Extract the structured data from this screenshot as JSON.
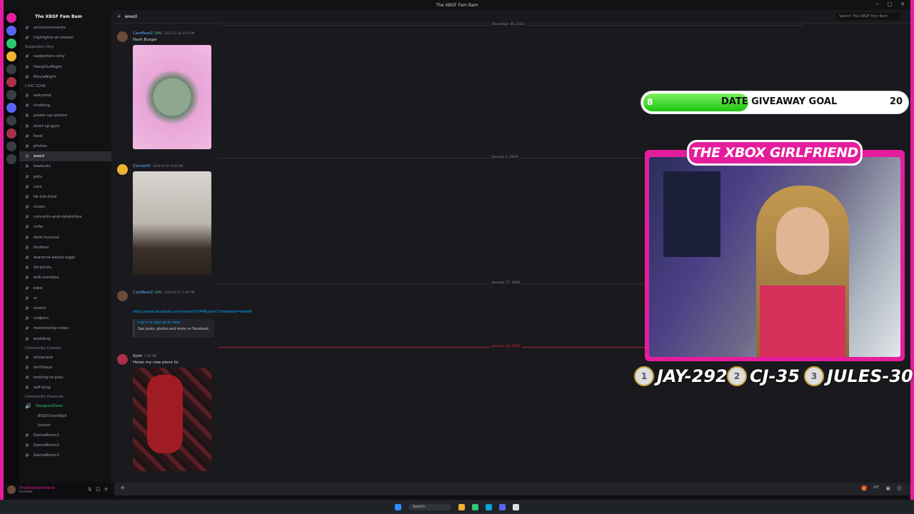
{
  "window": {
    "title": "The XBGF Fam Bam"
  },
  "server": {
    "name": "The XBGF Fam Bam"
  },
  "sidebar": {
    "top_channels": [
      {
        "label": "announcements"
      },
      {
        "label": "highlights-of-stream"
      }
    ],
    "categories": [
      {
        "name": "Supporters Only",
        "channels": [
          "supporters-only",
          "HangOutNight",
          "MovieNight"
        ]
      },
      {
        "name": "CHAT ZONE",
        "channels": [
          "welcome",
          "chatting",
          "power-up-station",
          "level-up-gym",
          "food",
          "photos",
          "weed",
          "loadouts",
          "pets",
          "cars",
          "tik-tok-time",
          "music",
          "concerts-and-celebrities",
          "nsfw",
          "dark-humour",
          "footfest",
          "warzone-easter-eggs",
          "3d-prints",
          "bo6-zombies",
          "bipd",
          "vr",
          "merch",
          "codpics",
          "relationship-news",
          "wedding"
        ]
      },
      {
        "name": "Community Connect",
        "channels": [
          "showcase",
          "birthdays",
          "looking-to-play",
          "self-plug"
        ]
      },
      {
        "name": "Community Channels",
        "channels": [
          "HangoutZone"
        ]
      }
    ],
    "voice_users": [
      "BIGDOnsonBack",
      "Jolsnen"
    ],
    "voice_channels": [
      "GameRoom1",
      "GameRoom2",
      "GameRoom3"
    ],
    "active_channel": "weed",
    "user": "TheXboxGirlfriend",
    "user_status": "Invisible"
  },
  "header": {
    "channel": "weed",
    "search_placeholder": "Search The XBGF Fam Bam"
  },
  "messages": [
    {
      "date": "December 30, 2023",
      "author": "CareBearZ",
      "tag": "SIMS",
      "time": "2023-12-30 4:03 PM",
      "text": "Hash Burger"
    },
    {
      "date": "January 1, 2024",
      "author": "Zzomb43",
      "time": "2024-01-01 9:04 PM",
      "text": ""
    },
    {
      "date": "January 17, 2024",
      "author": "CareBearZ",
      "tag": "SIMS",
      "time": "2024-01-17 1:40 PM",
      "text": "",
      "link": "https://www.facebook.com/share/r/1644Rj2emC/?mibextid=wwXIfr",
      "embed_title": "Log in or sign up to view",
      "embed_desc": "See posts, photos and more on Facebook."
    },
    {
      "date": "January 20, 2024",
      "author": "Kylet",
      "time": "1:26 AM",
      "text": "Heres my new piece liz"
    }
  ],
  "overlay": {
    "goal": {
      "start": "8",
      "label": "DATE GIVEAWAY GOAL",
      "end": "20",
      "progress": 0.4
    },
    "title": "THE XBOX GIRLFRIEND",
    "leaderboard": [
      {
        "rank": "1",
        "name": "JAY-292"
      },
      {
        "rank": "2",
        "name": "CJ-35"
      },
      {
        "rank": "3",
        "name": "JULES-30"
      }
    ]
  },
  "taskbar": {
    "search": "Search"
  },
  "colors": {
    "frame": "#e41d9c",
    "bg": "#1a1a1e",
    "link": "#00a8fc",
    "voice": "#2dc770"
  }
}
